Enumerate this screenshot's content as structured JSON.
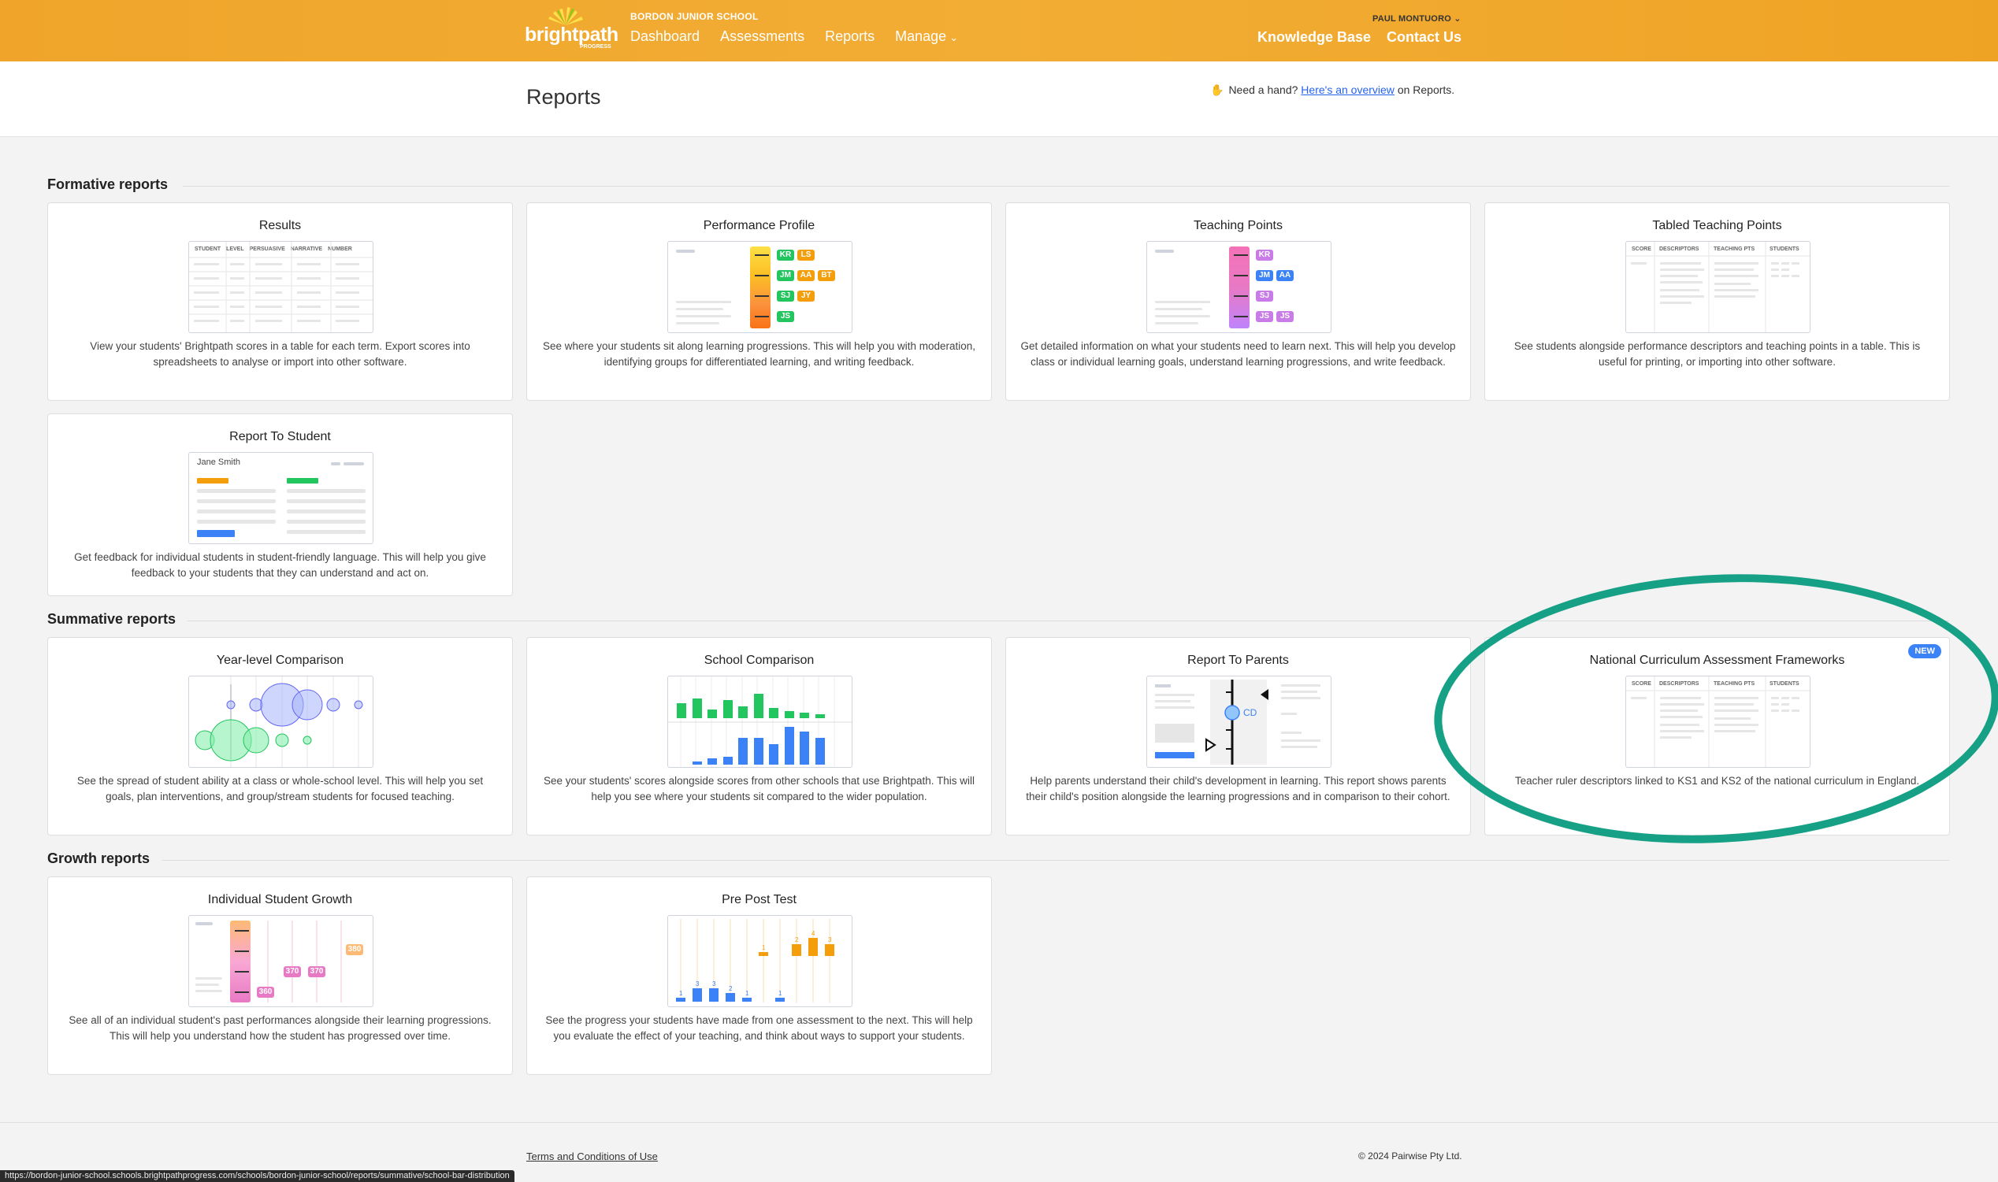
{
  "header": {
    "brand_word": "brightpath",
    "brand_sub": "PROGRESS",
    "school": "BORDON JUNIOR SCHOOL",
    "nav": [
      "Dashboard",
      "Assessments",
      "Reports",
      "Manage"
    ],
    "user": "PAUL MONTUORO",
    "right_nav": [
      "Knowledge Base",
      "Contact Us"
    ]
  },
  "page": {
    "title": "Reports",
    "help_prefix": "Need a hand?",
    "help_link": "Here's an overview",
    "help_suffix": "on Reports."
  },
  "sections": {
    "formative": "Formative reports",
    "summative": "Summative reports",
    "growth": "Growth reports"
  },
  "cards": {
    "results": {
      "title": "Results",
      "desc": "View your students' Brightpath scores in a table for each term. Export scores into spreadsheets to analyse or import into other software.",
      "thumb_headers": [
        "STUDENT",
        "LEVEL",
        "PERSUASIVE",
        "NARRATIVE",
        "NUMBER"
      ]
    },
    "performance": {
      "title": "Performance Profile",
      "desc": "See where your students sit along learning progressions. This will help you with moderation, identifying groups for differentiated learning, and writing feedback.",
      "pills": [
        "KR",
        "LS",
        "JM",
        "AA",
        "BT",
        "SJ",
        "JY",
        "JS"
      ]
    },
    "teaching": {
      "title": "Teaching Points",
      "desc": "Get detailed information on what your students need to learn next. This will help you develop class or individual learning goals, understand learning progressions, and write feedback.",
      "pills": [
        "KR",
        "JM",
        "AA",
        "SJ",
        "JS",
        "JS"
      ]
    },
    "tabled": {
      "title": "Tabled Teaching Points",
      "desc": "See students alongside performance descriptors and teaching points in a table. This is useful for printing, or importing into other software.",
      "thumb_headers": [
        "SCORE",
        "DESCRIPTORS",
        "TEACHING PTS",
        "STUDENTS"
      ]
    },
    "report_student": {
      "title": "Report To Student",
      "desc": "Get feedback for individual students in student-friendly language. This will help you give feedback to your students that they can understand and act on.",
      "student_name": "Jane Smith"
    },
    "year_level": {
      "title": "Year-level Comparison",
      "desc": "See the spread of student ability at a class or whole-school level. This will help you set goals, plan interventions, and group/stream students for focused teaching."
    },
    "school_comp": {
      "title": "School Comparison",
      "desc": "See your students' scores alongside scores from other schools that use Brightpath. This will help you see where your students sit compared to the wider population."
    },
    "report_parents": {
      "title": "Report To Parents",
      "desc": "Help parents understand their child's development in learning. This report shows parents their child's position alongside the learning progressions and in comparison to their cohort.",
      "marker": "CD"
    },
    "ncaf": {
      "title": "National Curriculum Assessment Frameworks",
      "desc": "Teacher ruler descriptors linked to KS1 and KS2 of the national curriculum in England.",
      "badge": "NEW",
      "thumb_headers": [
        "SCORE",
        "DESCRIPTORS",
        "TEACHING PTS",
        "STUDENTS"
      ]
    },
    "individual_growth": {
      "title": "Individual Student Growth",
      "desc": "See all of an individual student's past performances alongside their learning progressions. This will help you understand how the student has progressed over time.",
      "labels": [
        "360",
        "370",
        "370",
        "380"
      ]
    },
    "pre_post": {
      "title": "Pre Post Test",
      "desc": "See the progress your students have made from one assessment to the next. This will help you evaluate the effect of your teaching, and think about ways to support your students.",
      "labels": [
        "1",
        "3",
        "3",
        "2",
        "1",
        "1",
        "1",
        "2",
        "4",
        "3"
      ]
    }
  },
  "footer": {
    "terms": "Terms and Conditions of Use",
    "copyright": "© 2024 Pairwise Pty Ltd.",
    "status_url": "https://bordon-junior-school.schools.brightpathprogress.com/schools/bordon-junior-school/reports/summative/school-bar-distribution"
  },
  "colors": {
    "header": "#f2ad35",
    "highlight": "#16a085",
    "link": "#2563eb"
  }
}
